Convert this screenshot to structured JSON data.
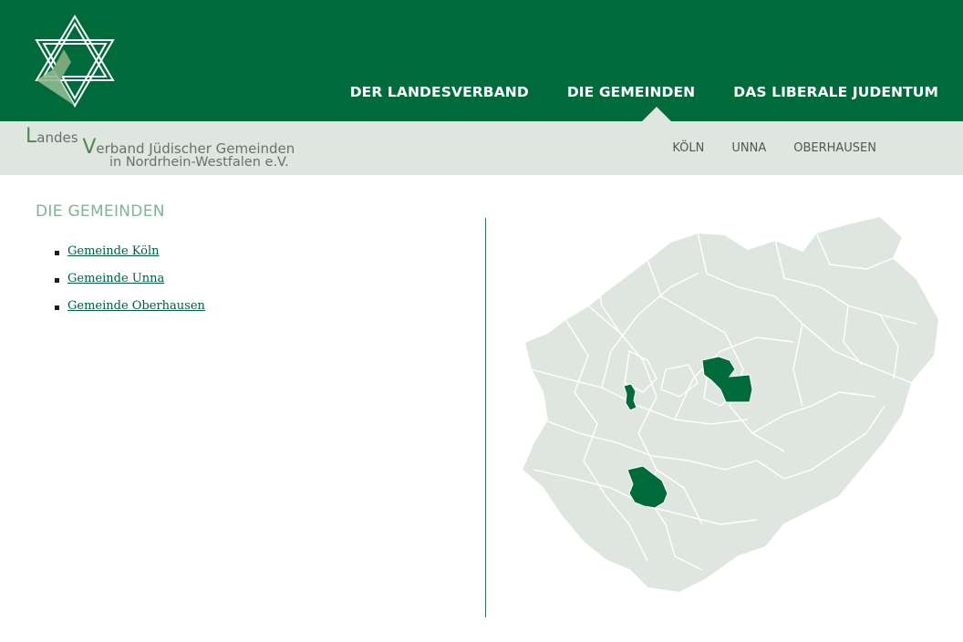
{
  "header": {
    "nav": [
      {
        "label": "DER LANDESVERBAND"
      },
      {
        "label": "DIE GEMEINDEN"
      },
      {
        "label": "DAS LIBERALE JUDENTUM"
      }
    ]
  },
  "brand": {
    "line1_initial": "L",
    "line1_rest": "andes",
    "line1b_initial": "V",
    "line1b_rest": "erband Jüdischer Gemeinden",
    "line2": "in Nordrhein-Westfalen e.V."
  },
  "subnav": [
    {
      "label": "KÖLN"
    },
    {
      "label": "UNNA"
    },
    {
      "label": "OBERHAUSEN"
    }
  ],
  "main": {
    "title": "DIE GEMEINDEN",
    "links": [
      {
        "label": "Gemeinde Köln"
      },
      {
        "label": "Gemeinde Unna"
      },
      {
        "label": "Gemeinde Oberhausen"
      }
    ]
  },
  "colors": {
    "brand_green": "#006b3a",
    "sub_bar": "#dfe6e0",
    "map_land": "#dfe6e0",
    "map_highlight": "#006b3a",
    "title_green": "#7fb596"
  }
}
